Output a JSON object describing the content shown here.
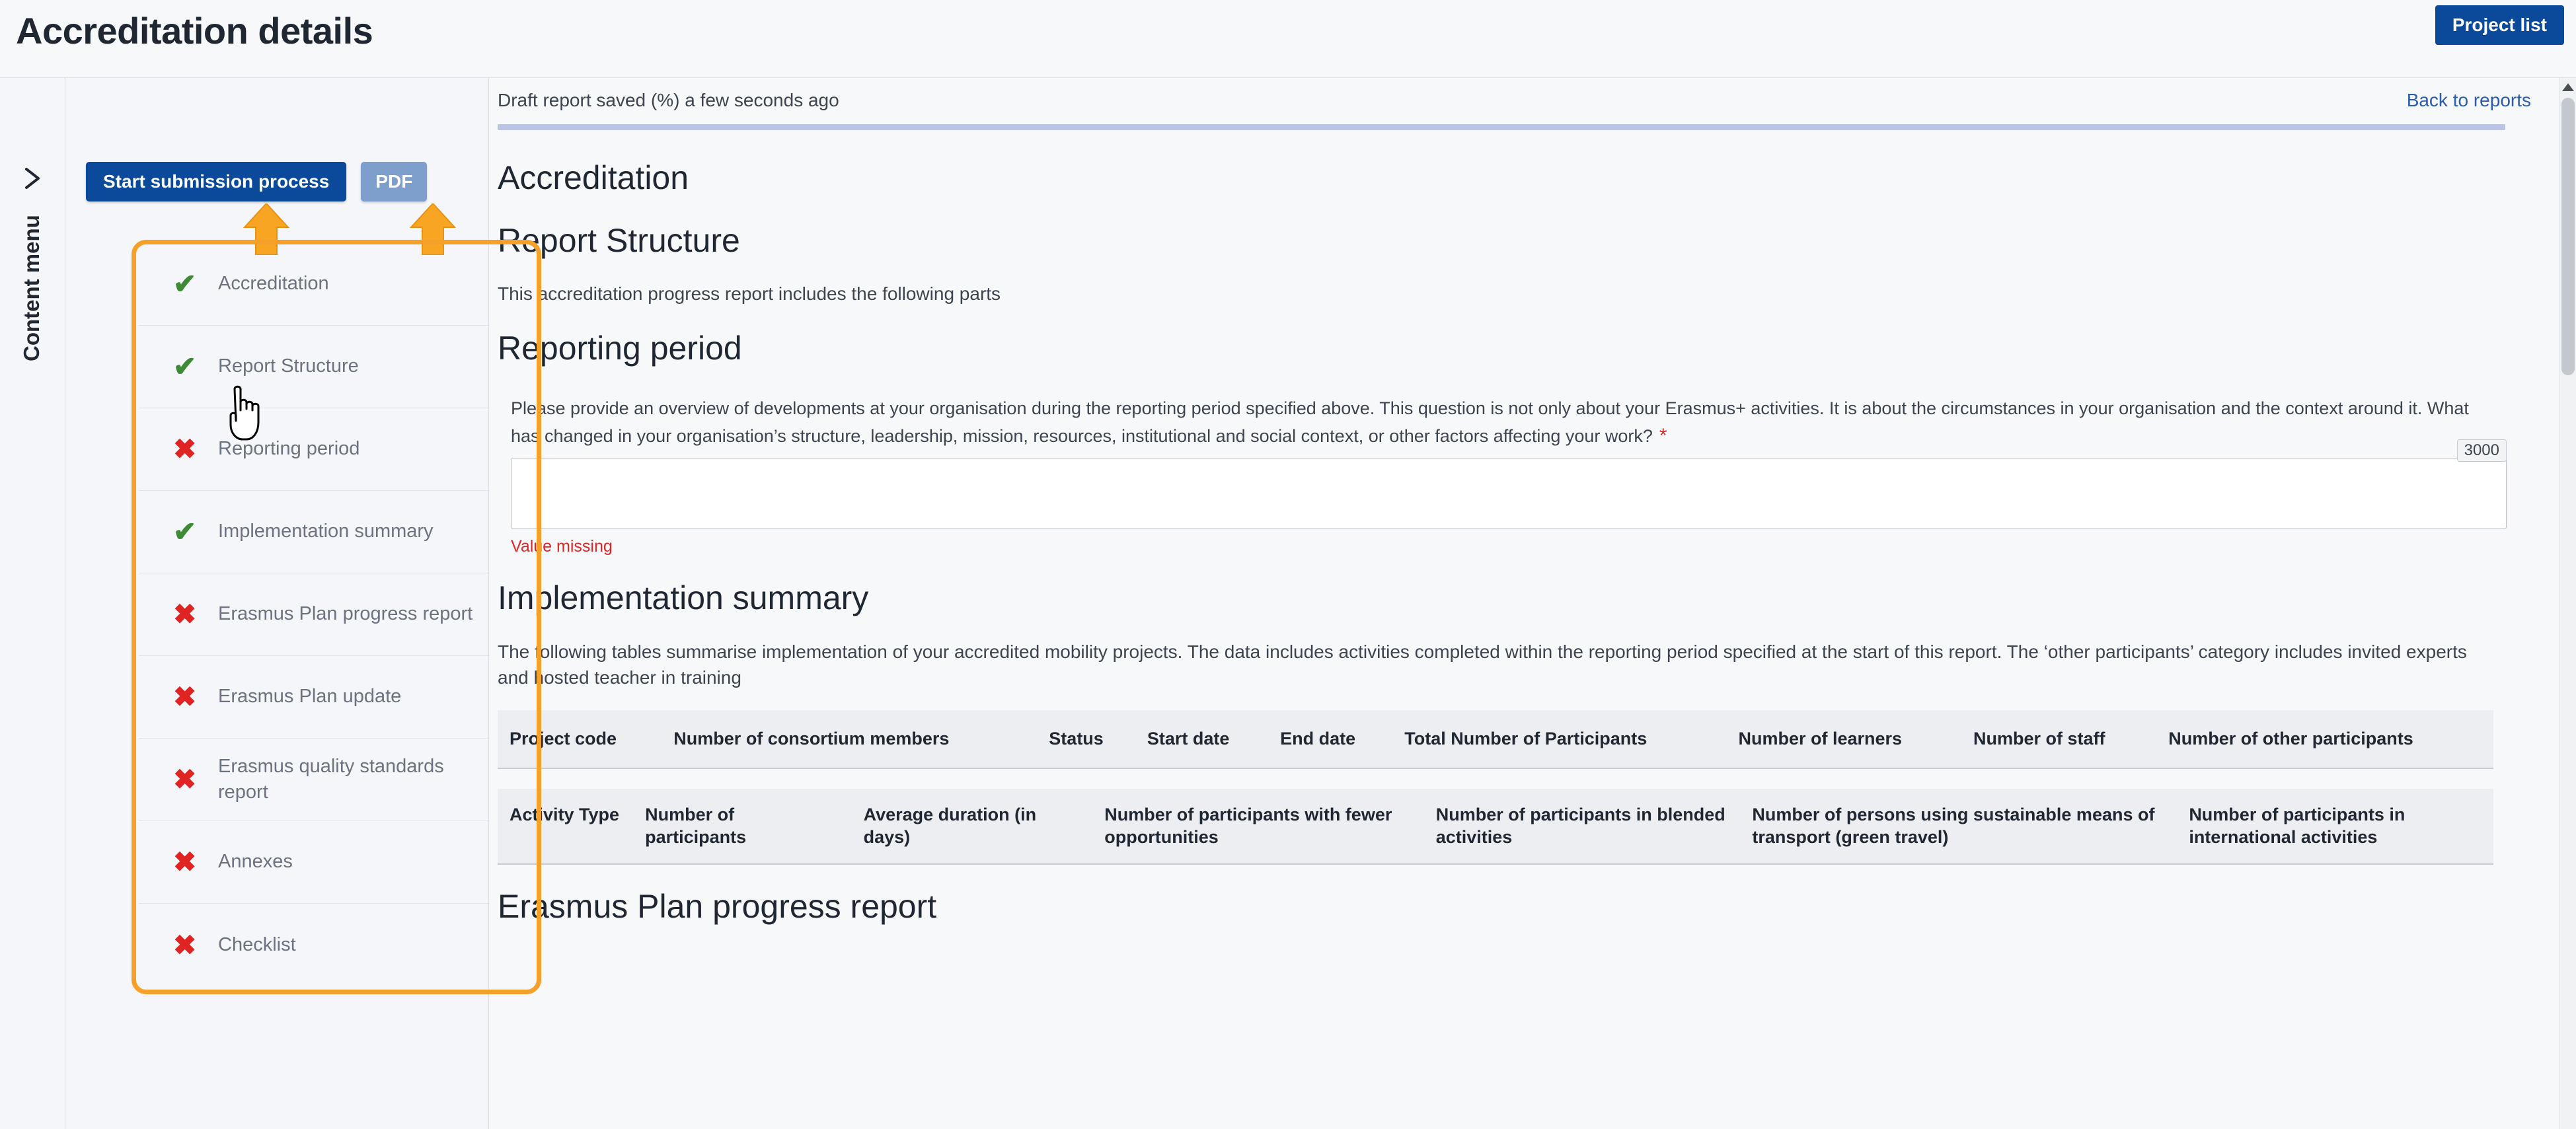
{
  "header": {
    "title": "Accreditation details",
    "project_list_label": "Project list"
  },
  "left_rail": {
    "expand_icon": "chevron-right-icon",
    "content_menu_label": "Content menu"
  },
  "sidebar": {
    "start_submission_label": "Start submission process",
    "pdf_label": "PDF",
    "items": [
      {
        "status": "ok",
        "icon": "check-icon",
        "label": "Accreditation"
      },
      {
        "status": "ok",
        "icon": "check-icon",
        "label": "Report Structure"
      },
      {
        "status": "err",
        "icon": "cross-icon",
        "label": "Reporting period"
      },
      {
        "status": "ok",
        "icon": "check-icon",
        "label": "Implementation summary"
      },
      {
        "status": "err",
        "icon": "cross-icon",
        "label": "Erasmus Plan progress report"
      },
      {
        "status": "err",
        "icon": "cross-icon",
        "label": "Erasmus Plan update"
      },
      {
        "status": "err",
        "icon": "cross-icon",
        "label": "Erasmus quality standards report"
      },
      {
        "status": "err",
        "icon": "cross-icon",
        "label": "Annexes"
      },
      {
        "status": "err",
        "icon": "cross-icon",
        "label": "Checklist"
      }
    ]
  },
  "status_bar": {
    "draft_saved_text": "Draft report saved (%) a few seconds ago",
    "back_to_reports_label": "Back to reports"
  },
  "main": {
    "accreditation_heading": "Accreditation",
    "report_structure_heading": "Report Structure",
    "report_structure_text": "This accreditation progress report includes the following parts",
    "reporting_period_heading": "Reporting period",
    "reporting_period_question": "Please provide an overview of developments at your organisation during the reporting period specified above. This question is not only about your Erasmus+ activities. It is about the circumstances in your organisation and the context around it. What has changed in your organisation’s structure, leadership, mission, resources, institutional and social context, or other factors affecting your work?",
    "required_marker": "*",
    "char_limit": "3000",
    "overview_value": "",
    "overview_placeholder": "",
    "value_missing_message": "Value missing",
    "implementation_summary_heading": "Implementation summary",
    "implementation_summary_text": "The following tables summarise implementation of your accredited mobility projects. The data includes activities completed within the reporting period specified at the start of this report. The ‘other participants’ category includes invited experts and hosted teacher in training",
    "erasmus_plan_progress_heading": "Erasmus Plan progress report"
  },
  "projects_table": {
    "headers": [
      "Project code",
      "Number of consortium members",
      "Status",
      "Start date",
      "End date",
      "Total Number of Participants",
      "Number of learners",
      "Number of staff",
      "Number of other participants"
    ],
    "rows": []
  },
  "activities_table": {
    "headers": [
      "Activity Type",
      "Number of participants",
      "Average duration (in days)",
      "Number of participants with fewer opportunities",
      "Number of participants in blended activities",
      "Number of persons using sustainable means of transport (green travel)",
      "Number of participants in international activities"
    ],
    "rows": []
  },
  "colors": {
    "primary_blue": "#0b4a9a",
    "secondary_blue": "#7e9ecb",
    "annotation_orange": "#f5a02b",
    "success_green": "#3e8a35",
    "error_red": "#e02424",
    "link_blue": "#2a5db0",
    "progress_lavender": "#bcc4e3"
  }
}
